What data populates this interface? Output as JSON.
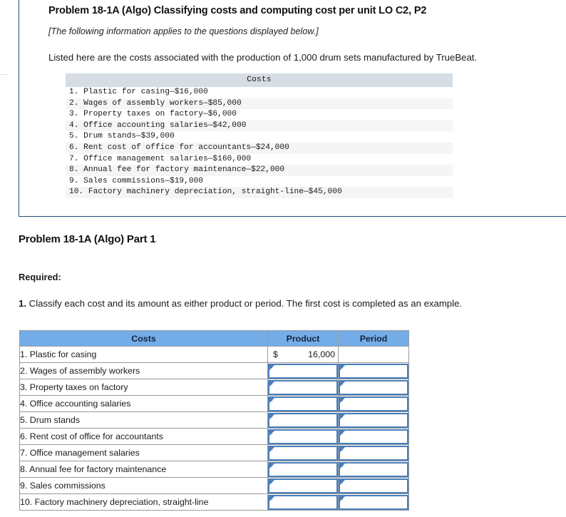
{
  "problem": {
    "title": "Problem 18-1A (Algo) Classifying costs and computing cost per unit LO C2, P2",
    "applies_note": "[The following information applies to the questions displayed below.]",
    "intro": "Listed here are the costs associated with the production of 1,000 drum sets manufactured by TrueBeat.",
    "costs_table_header": "Costs",
    "costs_lines": [
      "1. Plastic for casing—$16,000",
      "2. Wages of assembly workers—$85,000",
      "3. Property taxes on factory—$6,000",
      "4. Office accounting salaries—$42,000",
      "5. Drum stands—$39,000",
      "6. Rent cost of office for accountants—$24,000",
      "7. Office management salaries—$160,000",
      "8. Annual fee for factory maintenance—$22,000",
      "9. Sales commissions—$19,000",
      "10. Factory machinery depreciation, straight-line—$45,000"
    ]
  },
  "part": {
    "title": "Problem 18-1A (Algo) Part 1",
    "required_label": "Required:",
    "requirement_number": "1.",
    "requirement_text": " Classify each cost and its amount as either product or period. The first cost is completed as an example."
  },
  "answer_table": {
    "headers": {
      "costs": "Costs",
      "product": "Product",
      "period": "Period"
    },
    "rows": [
      {
        "label": "1. Plastic for casing",
        "product_currency": "$",
        "product_value": "16,000",
        "product_type": "amount",
        "period_type": "empty",
        "period_value": ""
      },
      {
        "label": "2. Wages of assembly workers",
        "product_type": "dropdown",
        "product_value": "",
        "period_type": "dropdown",
        "period_value": ""
      },
      {
        "label": "3. Property taxes on factory",
        "product_type": "dropdown",
        "product_value": "",
        "period_type": "dropdown",
        "period_value": ""
      },
      {
        "label": "4. Office accounting salaries",
        "product_type": "dropdown",
        "product_value": "",
        "period_type": "dropdown",
        "period_value": ""
      },
      {
        "label": "5. Drum stands",
        "product_type": "dropdown",
        "product_value": "",
        "period_type": "dropdown",
        "period_value": ""
      },
      {
        "label": "6. Rent cost of office for accountants",
        "product_type": "dropdown",
        "product_value": "",
        "period_type": "dropdown",
        "period_value": ""
      },
      {
        "label": "7. Office management salaries",
        "product_type": "dropdown",
        "product_value": "",
        "period_type": "dropdown",
        "period_value": ""
      },
      {
        "label": "8. Annual fee for factory maintenance",
        "product_type": "dropdown",
        "product_value": "",
        "period_type": "dropdown",
        "period_value": ""
      },
      {
        "label": "9. Sales commissions",
        "product_type": "dropdown",
        "product_value": "",
        "period_type": "dropdown",
        "period_value": ""
      },
      {
        "label": "10. Factory machinery depreciation, straight-line",
        "product_type": "dropdown",
        "product_value": "",
        "period_type": "dropdown",
        "period_value": ""
      }
    ]
  },
  "colors": {
    "card_border": "#1f4e79",
    "list_header_bg": "#d7dde5",
    "list_stripe_bg": "#f5f5f6",
    "table_header_bg": "#74ace8",
    "dropdown_border": "#4a7ebb",
    "cell_border": "#9a9a9a"
  }
}
